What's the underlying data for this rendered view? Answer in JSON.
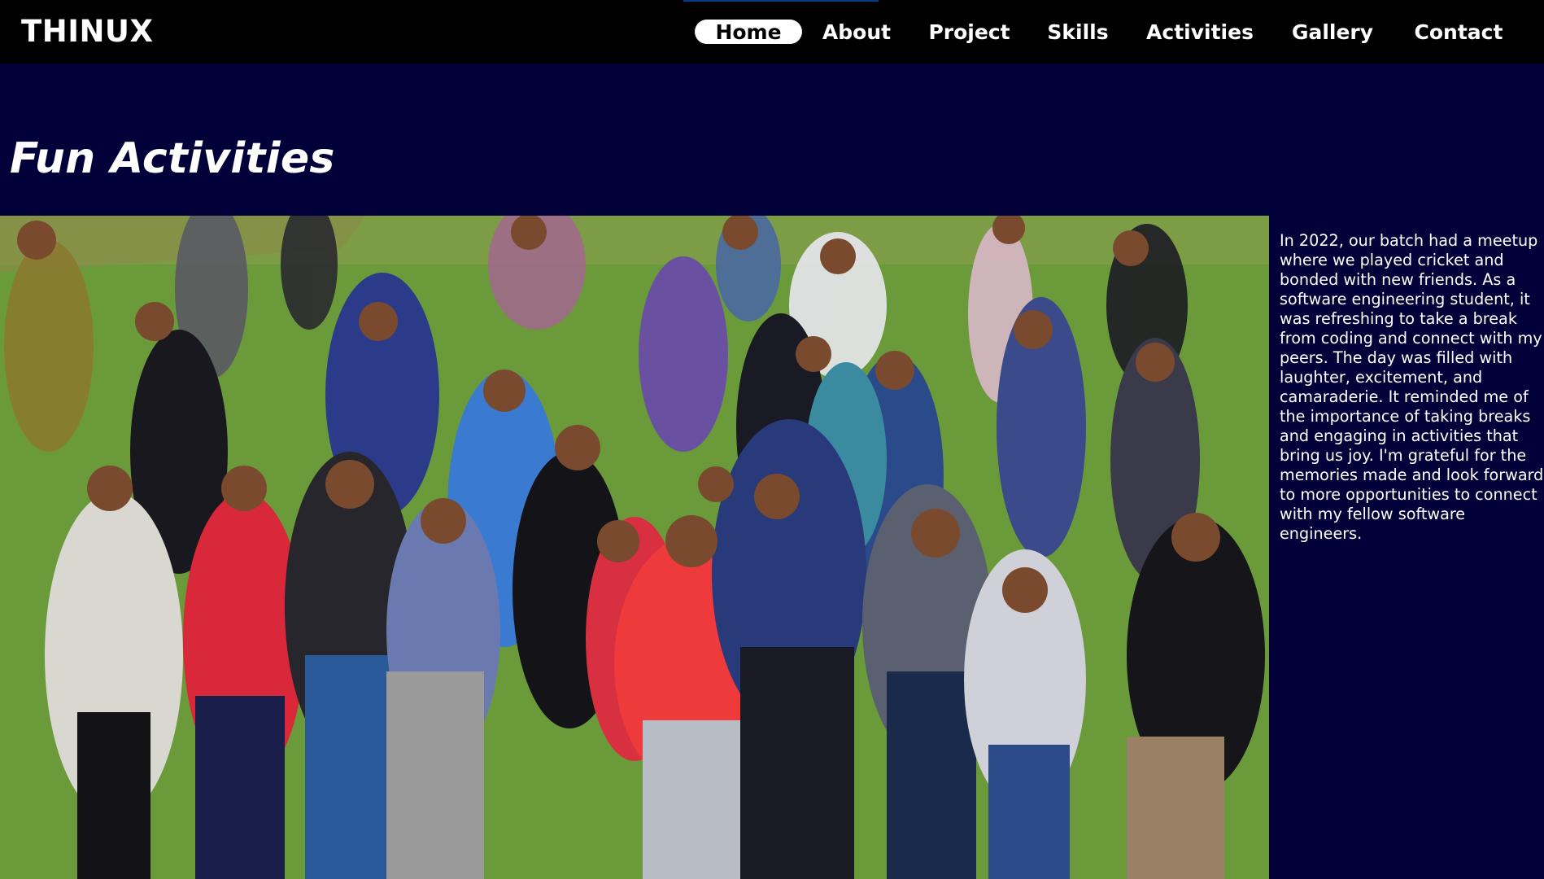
{
  "brand": "THINUX",
  "nav": {
    "items": [
      {
        "label": "Home",
        "active": true
      },
      {
        "label": "About",
        "active": false
      },
      {
        "label": "Project",
        "active": false
      },
      {
        "label": "Skills",
        "active": false
      },
      {
        "label": "Activities",
        "active": false
      },
      {
        "label": "Gallery",
        "active": false
      },
      {
        "label": "Contact",
        "active": false
      }
    ]
  },
  "section": {
    "title": "Fun Activities",
    "description": "In 2022, our batch had a meetup where we played cricket and bonded with new friends. As a software engineering student, it was refreshing to take a break from coding and connect with my peers. The day was filled with laughter, excitement, and camaraderie. It reminded me of the importance of taking breaks and engaging in activities that bring us joy. I'm grateful for the memories made and look forward to more opportunities to connect with my fellow software engineers."
  },
  "colors": {
    "navbar_bg": "#000000",
    "page_bg": "#010038",
    "text": "#ffffff",
    "active_pill": "#ffffff"
  }
}
